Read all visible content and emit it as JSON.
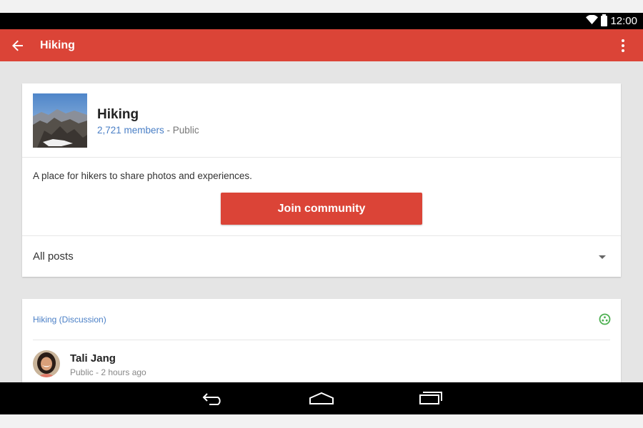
{
  "status_bar": {
    "time": "12:00",
    "wifi_icon": "wifi-icon",
    "battery_icon": "battery-icon"
  },
  "app_bar": {
    "title": "Hiking",
    "back_icon": "arrow-back-icon",
    "menu_icon": "more-vert-icon",
    "color": "#db4437"
  },
  "community": {
    "name": "Hiking",
    "members": "2,721 members",
    "separator": " - ",
    "visibility": "Public",
    "description": "A place for hikers to share photos and experiences.",
    "join_label": "Join community",
    "filter_label": "All posts",
    "filter_icon": "dropdown-arrow-icon"
  },
  "post": {
    "community_label": "Hiking (Discussion)",
    "indicator_icon": "community-circle-icon",
    "author": "Tali Jang",
    "meta": "Public - 2 hours ago"
  },
  "nav_bar": {
    "back_icon": "nav-back-icon",
    "home_icon": "nav-home-icon",
    "recents_icon": "nav-recents-icon"
  },
  "colors": {
    "accent": "#db4437",
    "link": "#4a7fc6",
    "indicator": "#4caf50"
  }
}
